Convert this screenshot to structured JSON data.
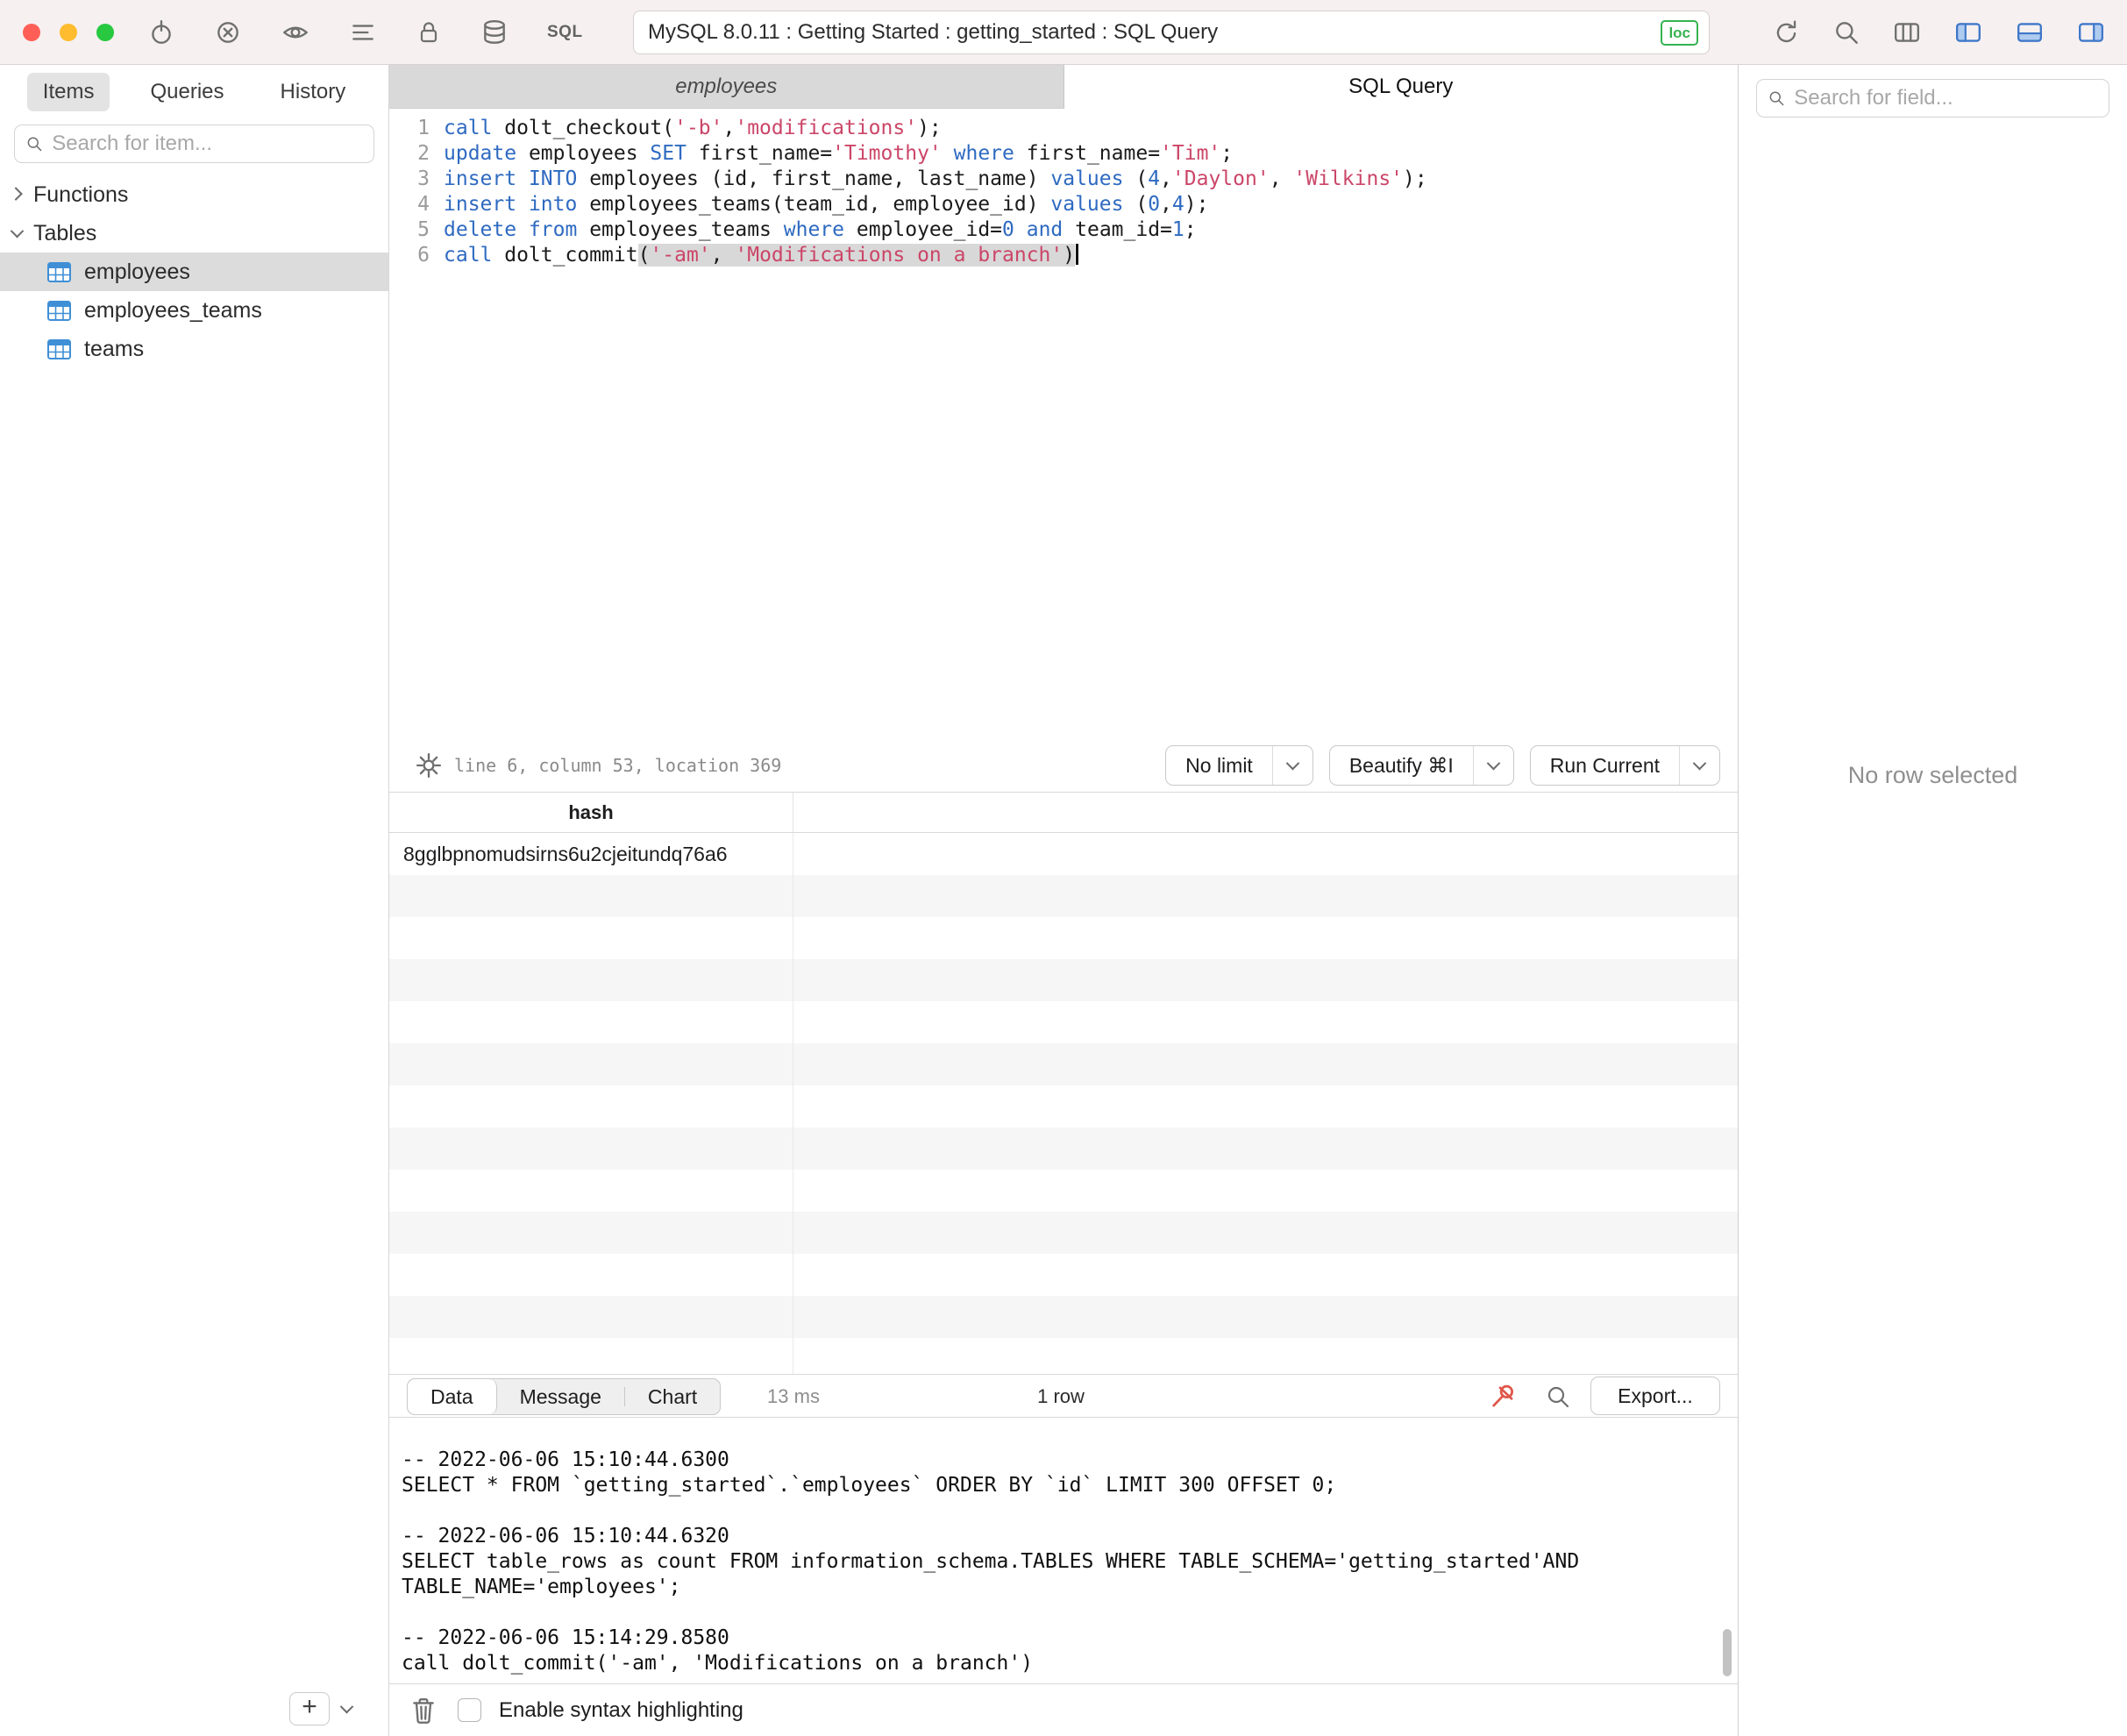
{
  "titlebar": {
    "title": "MySQL 8.0.11 : Getting Started : getting_started : SQL Query",
    "connection_badge": "loc",
    "sql_label": "SQL",
    "left_icons": [
      "power-icon",
      "disconnect-icon",
      "eye-icon",
      "log-icon",
      "lock-icon",
      "database-icon",
      "sql-badge"
    ],
    "right_icons": [
      "refresh-icon",
      "search-icon",
      "window-panes-icon",
      "toggle-left-panel-icon",
      "toggle-bottom-panel-icon",
      "toggle-right-panel-icon"
    ]
  },
  "sidebar": {
    "tabs": [
      {
        "label": "Items",
        "active": true
      },
      {
        "label": "Queries",
        "active": false
      },
      {
        "label": "History",
        "active": false
      }
    ],
    "search_placeholder": "Search for item...",
    "functions_label": "Functions",
    "tables_label": "Tables",
    "tables": [
      {
        "name": "employees",
        "selected": true
      },
      {
        "name": "employees_teams",
        "selected": false
      },
      {
        "name": "teams",
        "selected": false
      }
    ],
    "add_button": "+"
  },
  "editor_tabs": {
    "left": "employees",
    "right": "SQL Query"
  },
  "editor": {
    "status": "line 6, column 53, location 369",
    "lines": [
      {
        "tokens": [
          [
            "k",
            "call"
          ],
          [
            "t",
            " dolt_checkout("
          ],
          [
            "s",
            "'-b'"
          ],
          [
            "t",
            ","
          ],
          [
            "s",
            "'modifications'"
          ],
          [
            "t",
            ");"
          ]
        ]
      },
      {
        "tokens": [
          [
            "k",
            "update"
          ],
          [
            "t",
            " employees "
          ],
          [
            "k",
            "SET"
          ],
          [
            "t",
            " first_name="
          ],
          [
            "s",
            "'Timothy'"
          ],
          [
            "t",
            " "
          ],
          [
            "k",
            "where"
          ],
          [
            "t",
            " first_name="
          ],
          [
            "s",
            "'Tim'"
          ],
          [
            "t",
            ";"
          ]
        ]
      },
      {
        "tokens": [
          [
            "k",
            "insert"
          ],
          [
            "t",
            " "
          ],
          [
            "k",
            "INTO"
          ],
          [
            "t",
            " employees (id, first_name, last_name) "
          ],
          [
            "k",
            "values"
          ],
          [
            "t",
            " ("
          ],
          [
            "n",
            "4"
          ],
          [
            "t",
            ","
          ],
          [
            "s",
            "'Daylon'"
          ],
          [
            "t",
            ", "
          ],
          [
            "s",
            "'Wilkins'"
          ],
          [
            "t",
            ");"
          ]
        ]
      },
      {
        "tokens": [
          [
            "k",
            "insert"
          ],
          [
            "t",
            " "
          ],
          [
            "k",
            "into"
          ],
          [
            "t",
            " employees_teams(team_id, employee_id) "
          ],
          [
            "k",
            "values"
          ],
          [
            "t",
            " ("
          ],
          [
            "n",
            "0"
          ],
          [
            "t",
            ","
          ],
          [
            "n",
            "4"
          ],
          [
            "t",
            ");"
          ]
        ]
      },
      {
        "tokens": [
          [
            "k",
            "delete"
          ],
          [
            "t",
            " "
          ],
          [
            "k",
            "from"
          ],
          [
            "t",
            " employees_teams "
          ],
          [
            "k",
            "where"
          ],
          [
            "t",
            " employee_id="
          ],
          [
            "n",
            "0"
          ],
          [
            "t",
            " "
          ],
          [
            "k",
            "and"
          ],
          [
            "t",
            " team_id="
          ],
          [
            "n",
            "1"
          ],
          [
            "t",
            ";"
          ]
        ]
      },
      {
        "tokens": [
          [
            "k",
            "call"
          ],
          [
            "t",
            " dolt_commit"
          ],
          [
            "t",
            "(",
            1
          ],
          [
            "s",
            "'-am'",
            1
          ],
          [
            "t",
            ", ",
            1
          ],
          [
            "s",
            "'Modifications on a branch'",
            1
          ],
          [
            "t",
            ")",
            1
          ]
        ],
        "cursor": true
      }
    ]
  },
  "controls": {
    "limit": "No limit",
    "beautify": "Beautify ⌘I",
    "run": "Run Current"
  },
  "results": {
    "column_header": "hash",
    "rows": [
      "8gglbpnomudsirns6u2cjeitundq76a6"
    ],
    "visible_rows": 13
  },
  "result_bar": {
    "segments": [
      "Data",
      "Message",
      "Chart"
    ],
    "active": "Data",
    "duration": "13 ms",
    "row_count": "1 row",
    "export_label": "Export..."
  },
  "console": {
    "lines": [
      "-- 2022-06-06 15:10:44.6300",
      "SELECT * FROM `getting_started`.`employees` ORDER BY `id` LIMIT 300 OFFSET 0;",
      "",
      "-- 2022-06-06 15:10:44.6320",
      "SELECT table_rows as count FROM information_schema.TABLES WHERE TABLE_SCHEMA='getting_started'AND",
      "TABLE_NAME='employees';",
      "",
      "-- 2022-06-06 15:14:29.8580",
      "call dolt_commit('-am', 'Modifications on a branch')"
    ]
  },
  "footer": {
    "syntax_checkbox_label": "Enable syntax highlighting",
    "checked": false
  },
  "right_panel": {
    "search_placeholder": "Search for field...",
    "empty_text": "No row selected"
  },
  "colors": {
    "keyword": "#2e6ac1",
    "string": "#cb4668",
    "number": "#2e6ac1",
    "accent_green": "#35b350",
    "selection_gray": "#dcdcdc",
    "traffic_red": "#ff5f57",
    "traffic_yellow": "#febc2e",
    "traffic_green": "#28c840"
  }
}
